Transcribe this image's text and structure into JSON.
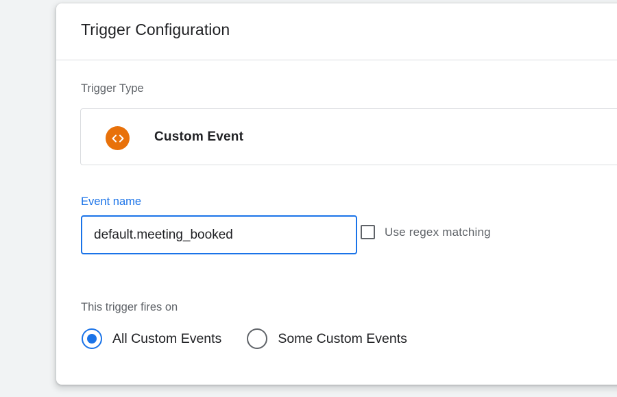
{
  "panel": {
    "title": "Trigger Configuration"
  },
  "trigger_type": {
    "section_label": "Trigger Type",
    "name": "Custom Event",
    "icon": "code-brackets-icon",
    "icon_color": "#e8710a"
  },
  "event_name": {
    "label": "Event name",
    "value": "default.meeting_booked",
    "regex_label": "Use regex matching",
    "regex_checked": false
  },
  "fires_on": {
    "section_label": "This trigger fires on",
    "options": [
      {
        "label": "All Custom Events",
        "selected": true
      },
      {
        "label": "Some Custom Events",
        "selected": false
      }
    ]
  },
  "colors": {
    "accent": "#1a73e8",
    "text_primary": "#202124",
    "text_secondary": "#5f6368",
    "border": "#dadce0",
    "background": "#f1f3f4"
  }
}
